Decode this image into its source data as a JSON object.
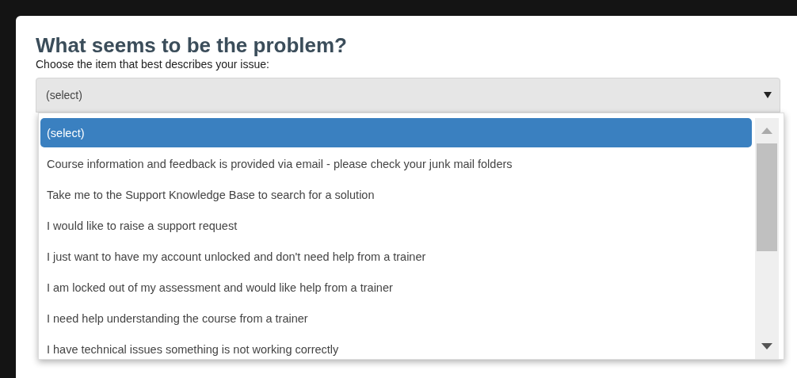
{
  "title": "What seems to be the problem?",
  "subtitle": "Choose the item that best describes your issue:",
  "select": {
    "value": "(select)",
    "expanded": true
  },
  "options": [
    {
      "label": "(select)",
      "selected": true
    },
    {
      "label": "Course information and feedback is provided via email - please check your junk mail folders",
      "selected": false
    },
    {
      "label": "Take me to the Support Knowledge Base to search for a solution",
      "selected": false
    },
    {
      "label": "I would like to raise a support request",
      "selected": false
    },
    {
      "label": "I just want to have my account unlocked and don't need help from a trainer",
      "selected": false
    },
    {
      "label": "I am locked out of my assessment and would like help from a trainer",
      "selected": false
    },
    {
      "label": "I need help understanding the course from a trainer",
      "selected": false
    },
    {
      "label": "I have technical issues something is not working correctly",
      "selected": false
    }
  ]
}
